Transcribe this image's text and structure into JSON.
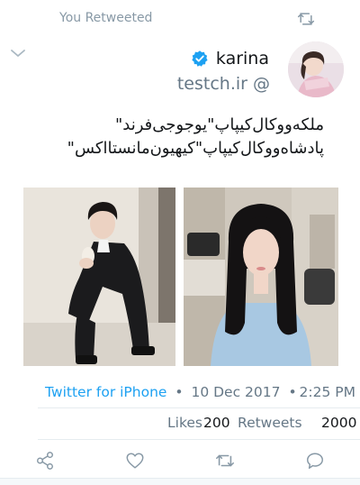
{
  "header": {
    "retweet_label": "You Retweeted",
    "retweet_icon": "retweet-icon",
    "menu_icon": "chevron-down-icon"
  },
  "author": {
    "display_name": "karina",
    "handle": "testch.ir @",
    "verified_icon": "verified-badge-icon",
    "avatar": "avatar"
  },
  "tweet": {
    "text_lines": [
      "ملکه‌ووکال‌کیپاپ\"یوجوجی‌فرند\"",
      "پادشاه‌ووکال‌کیپاپ\"کیهیون‌مانستااکس\""
    ]
  },
  "meta": {
    "source": "Twitter for iPhone",
    "dot1": "•",
    "date": "10 Dec 2017",
    "dot2": "•",
    "time": "2:25 PM"
  },
  "stats": {
    "likes_label": "Likes",
    "likes_count": "200",
    "retweets_label": "Retweets",
    "retweets_count": "2000"
  },
  "actions": {
    "share_icon": "share-icon",
    "like_icon": "heart-icon",
    "retweet_icon": "retweet-icon",
    "reply_icon": "reply-icon"
  },
  "colors": {
    "accent": "#1da1f2",
    "muted": "#657786",
    "light_muted": "#8899a6"
  }
}
